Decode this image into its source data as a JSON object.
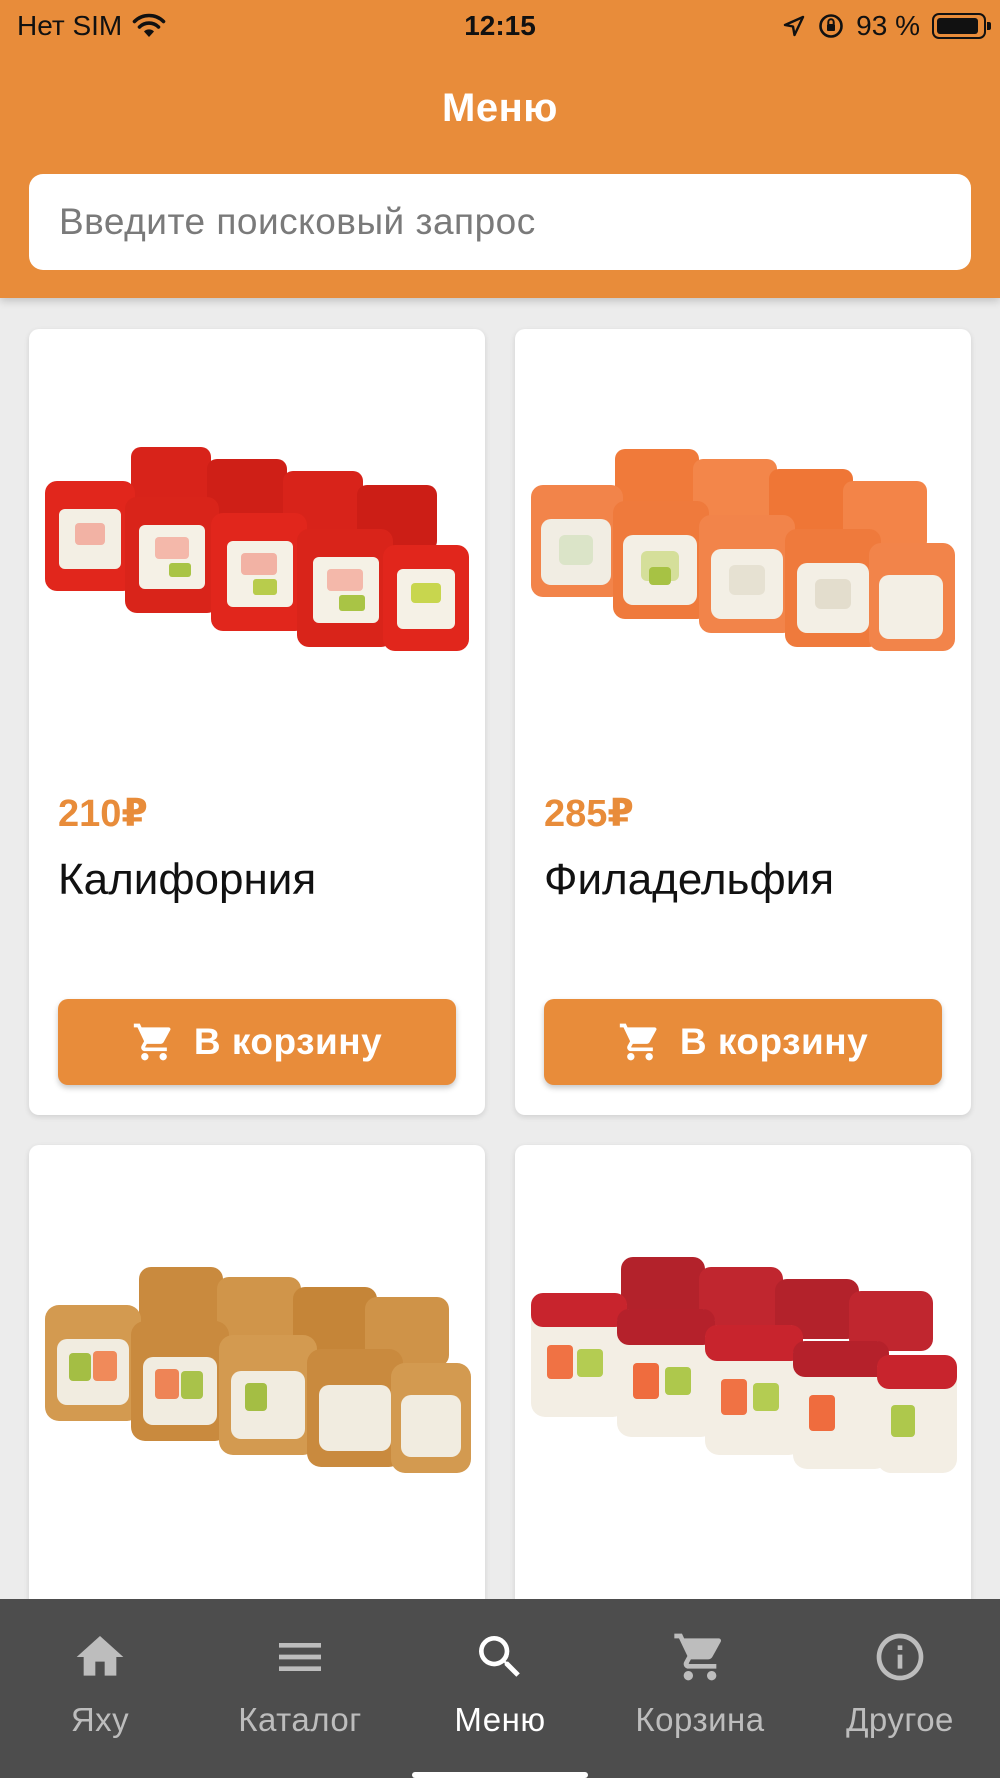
{
  "status_bar": {
    "carrier": "Нет SIM",
    "time": "12:15",
    "battery": "93 %",
    "battery_level": 0.93
  },
  "header": {
    "title": "Меню"
  },
  "search": {
    "placeholder": "Введите поисковый запрос"
  },
  "products": [
    {
      "price": "210₽",
      "name": "Калифорния",
      "button_label": "В корзину"
    },
    {
      "price": "285₽",
      "name": "Филадельфия",
      "button_label": "В корзину"
    },
    {
      "price": "",
      "name": "",
      "button_label": ""
    },
    {
      "price": "",
      "name": "",
      "button_label": ""
    }
  ],
  "bottom_nav": {
    "items": [
      {
        "label": "Яху",
        "icon": "home-icon"
      },
      {
        "label": "Каталог",
        "icon": "menu-lines-icon"
      },
      {
        "label": "Меню",
        "icon": "search-icon",
        "active": true
      },
      {
        "label": "Корзина",
        "icon": "cart-icon"
      },
      {
        "label": "Другое",
        "icon": "info-icon"
      }
    ]
  },
  "colors": {
    "accent": "#E88C3A",
    "nav_background": "#4d4d4d",
    "nav_inactive": "#bdbdbd",
    "nav_active": "#ffffff"
  }
}
